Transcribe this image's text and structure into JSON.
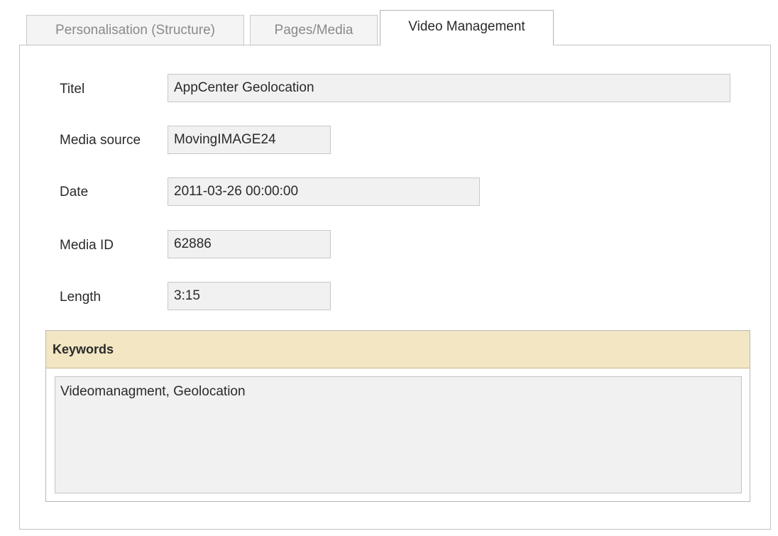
{
  "tabs": [
    {
      "label": "Personalisation (Structure)",
      "active": false
    },
    {
      "label": "Pages/Media",
      "active": false
    },
    {
      "label": "Video Management",
      "active": true
    }
  ],
  "form": {
    "title_label": "Titel",
    "title_value": "AppCenter Geolocation",
    "media_source_label": "Media source",
    "media_source_value": "MovingIMAGE24",
    "date_label": "Date",
    "date_value": "2011-03-26 00:00:00",
    "media_id_label": "Media ID",
    "media_id_value": "62886",
    "length_label": "Length",
    "length_value": "3:15"
  },
  "keywords": {
    "header": "Keywords",
    "value": "Videomanagment, Geolocation"
  },
  "colors": {
    "keywords_header_bg": "#f2e6c3",
    "field_bg": "#f1f1f1"
  }
}
